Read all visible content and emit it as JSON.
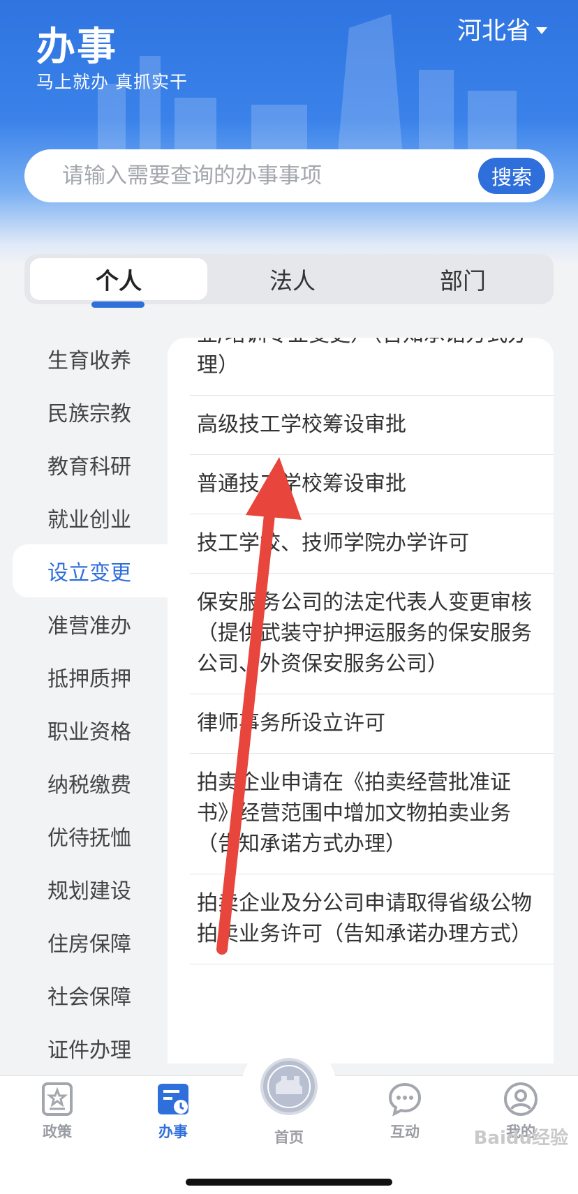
{
  "header": {
    "title": "办事",
    "slogan": "马上就办   真抓实干",
    "province": "河北省"
  },
  "search": {
    "placeholder": "请输入需要查询的办事事项",
    "button": "搜索"
  },
  "tabs": [
    {
      "label": "个人",
      "active": true
    },
    {
      "label": "法人",
      "active": false
    },
    {
      "label": "部门",
      "active": false
    }
  ],
  "sidebar": {
    "items": [
      {
        "label": "生育收养"
      },
      {
        "label": "民族宗教"
      },
      {
        "label": "教育科研"
      },
      {
        "label": "就业创业"
      },
      {
        "label": "设立变更",
        "active": true
      },
      {
        "label": "准营准办"
      },
      {
        "label": "抵押质押"
      },
      {
        "label": "职业资格"
      },
      {
        "label": "纳税缴费"
      },
      {
        "label": "优待抚恤"
      },
      {
        "label": "规划建设"
      },
      {
        "label": "住房保障"
      },
      {
        "label": "社会保障"
      },
      {
        "label": "证件办理"
      }
    ]
  },
  "list": {
    "items": [
      {
        "label": "业/培训专业变更）（告知承诺方式办理）"
      },
      {
        "label": "高级技工学校筹设审批"
      },
      {
        "label": "普通技工学校筹设审批"
      },
      {
        "label": "技工学校、技师学院办学许可"
      },
      {
        "label": "保安服务公司的法定代表人变更审核（提供武装守护押运服务的保安服务公司、外资保安服务公司）"
      },
      {
        "label": "律师事务所设立许可"
      },
      {
        "label": "拍卖企业申请在《拍卖经营批准证书》经营范围中增加文物拍卖业务（告知承诺方式办理）"
      },
      {
        "label": "拍卖企业及分公司申请取得省级公物拍卖业务许可（告知承诺办理方式）"
      }
    ]
  },
  "bottom_nav": {
    "policy": "政策",
    "affairs": "办事",
    "home": "首页",
    "interact": "互动",
    "mine": "我的"
  },
  "watermark": "Baidu经验",
  "colors": {
    "accent": "#2f6fdb",
    "annotation_arrow": "#e8453c"
  }
}
